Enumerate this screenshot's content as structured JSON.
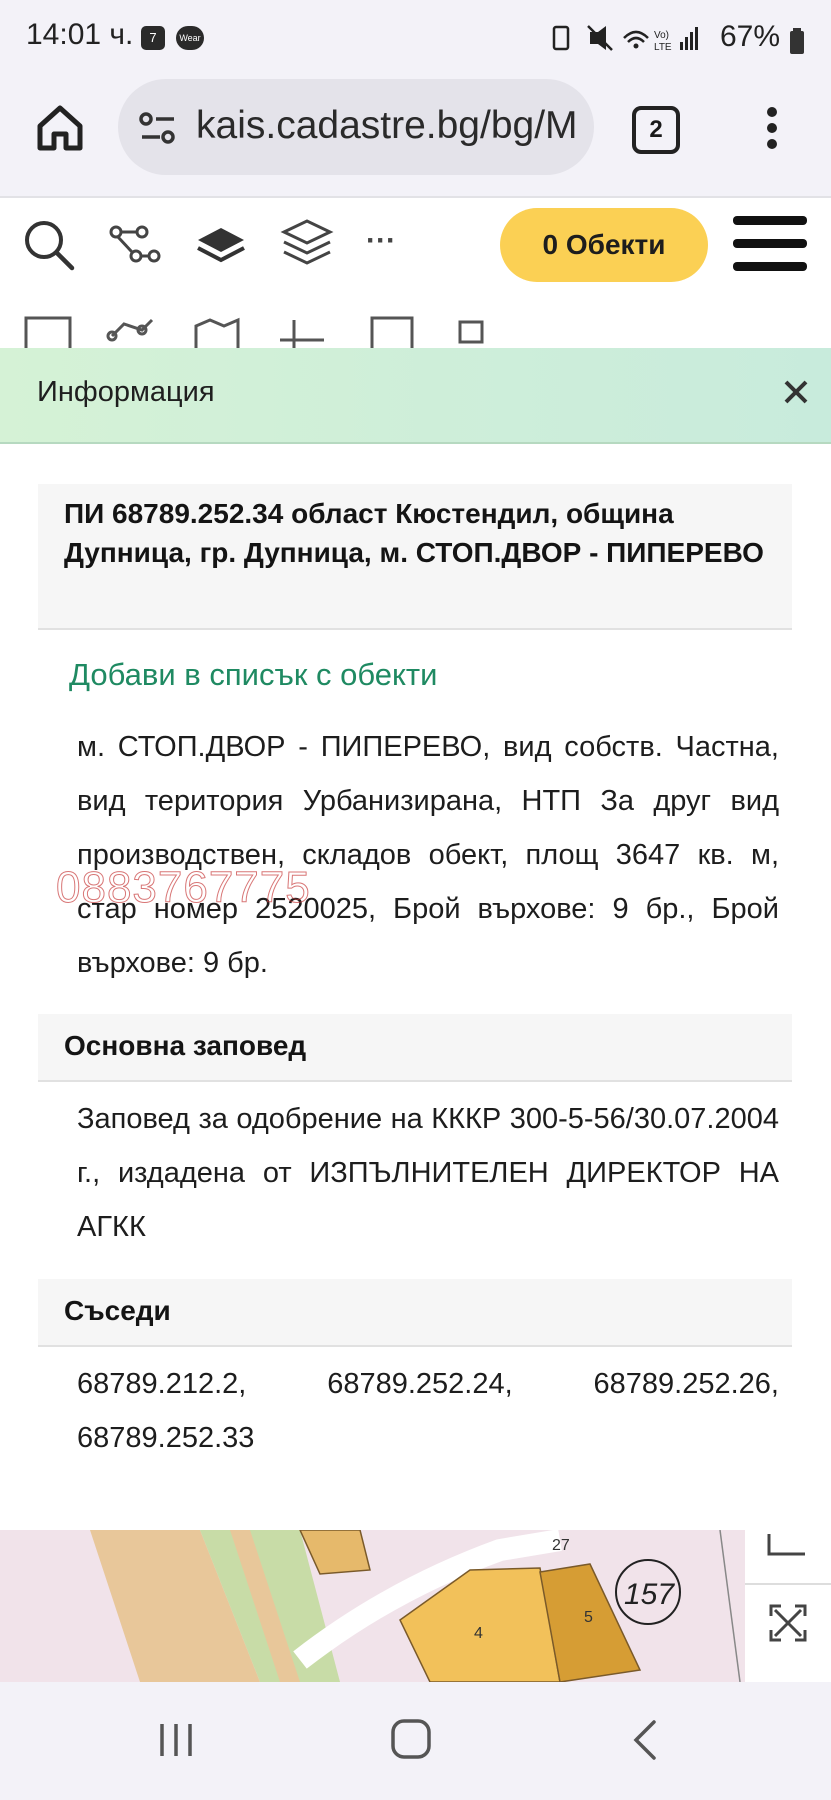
{
  "status_bar": {
    "time": "14:01 ч.",
    "notification_badge_1": "7",
    "notification_badge_2": "Wear",
    "battery_percent": "67%"
  },
  "browser": {
    "url": "kais.cadastre.bg/bg/M",
    "tab_count": "2"
  },
  "toolbar": {
    "objects_button": "0 Обекти",
    "more_label": "···"
  },
  "info_panel": {
    "title": "Информация",
    "parcel_title": "ПИ 68789.252.34 област Кюстендил, община Дупница, гр. Дупница, м. СТОП.ДВОР - ПИПЕРЕВО",
    "add_to_list": "Добави в списък с обекти",
    "parcel_details": "м. СТОП.ДВОР - ПИПЕРЕВО, вид собств. Частна, вид територия Урбанизирана, НТП За друг вид производствен, складов обект, площ 3647 кв. м, стар номер 2520025, Брой върхове: 9 бр., Брой върхове: 9 бр.",
    "watermark": "0883767775",
    "order_heading": "Основна заповед",
    "order_text": "Заповед за одобрение на КККР 300-5-56/30.07.2004 г., издадена от ИЗПЪЛНИТЕЛЕН ДИРЕКТОР НА АГКК",
    "neighbors_heading": "Съседи",
    "neighbors_text": "68789.212.2, 68789.252.24, 68789.252.26, 68789.252.33"
  },
  "map": {
    "labels": [
      "27",
      "5",
      "4",
      "157"
    ]
  },
  "colors": {
    "accent_yellow": "#fbd054",
    "info_header": "#d5f2d6",
    "link_green": "#1f8a62"
  }
}
